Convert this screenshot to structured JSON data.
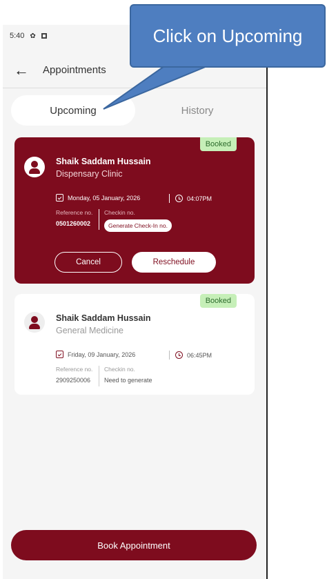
{
  "status_bar": {
    "time": "5:40"
  },
  "header": {
    "title": "Appointments"
  },
  "tabs": [
    {
      "label": "Upcoming",
      "active": true
    },
    {
      "label": "History",
      "active": false
    }
  ],
  "appointments": [
    {
      "status": "Booked",
      "name": "Shaik Saddam Hussain",
      "department": "Dispensary Clinic",
      "date": "Monday, 05 January, 2026",
      "time": "04:07PM",
      "reference_label": "Reference no.",
      "reference": "0501260002",
      "checkin_label": "Checkin no.",
      "checkin_action": "Generate Check-In no.",
      "cancel_label": "Cancel",
      "reschedule_label": "Reschedule"
    },
    {
      "status": "Booked",
      "name": "Shaik Saddam Hussain",
      "department": "General Medicine",
      "date": "Friday, 09 January, 2026",
      "time": "06:45PM",
      "reference_label": "Reference no.",
      "reference": "2909250006",
      "checkin_label": "Checkin no.",
      "checkin": "Need to generate"
    }
  ],
  "footer": {
    "book_label": "Book Appointment"
  },
  "annotation": {
    "text": "Click on Upcoming"
  },
  "colors": {
    "primary": "#7e0c1e",
    "badge": "#c6efb8",
    "callout": "#4e7ec0"
  }
}
